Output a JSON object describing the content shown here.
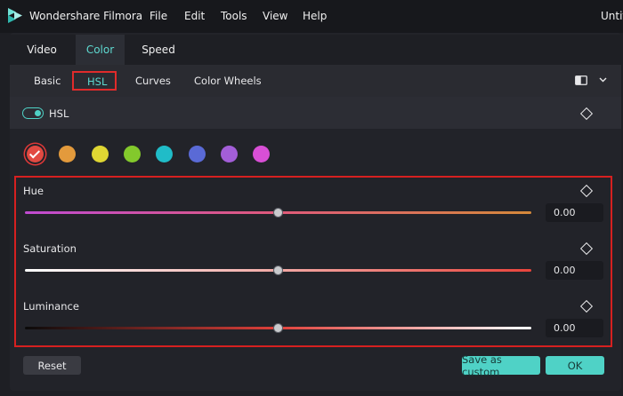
{
  "app": {
    "name": "Wondershare Filmora",
    "doc_title": "Untitled"
  },
  "menu": [
    "File",
    "Edit",
    "Tools",
    "View",
    "Help"
  ],
  "tabs": [
    {
      "label": "Video",
      "active": false
    },
    {
      "label": "Color",
      "active": true
    },
    {
      "label": "Speed",
      "active": false
    }
  ],
  "subtabs": [
    {
      "label": "Basic",
      "active": false
    },
    {
      "label": "HSL",
      "active": true
    },
    {
      "label": "Curves",
      "active": false
    },
    {
      "label": "Color Wheels",
      "active": false
    }
  ],
  "hsl_section": {
    "label": "HSL",
    "enabled": true
  },
  "swatches": [
    {
      "name": "red",
      "color": "#e24a42",
      "selected": true
    },
    {
      "name": "orange",
      "color": "#e39a3c",
      "selected": false
    },
    {
      "name": "yellow",
      "color": "#dfd633",
      "selected": false
    },
    {
      "name": "green",
      "color": "#83c92c",
      "selected": false
    },
    {
      "name": "cyan",
      "color": "#20bcc8",
      "selected": false
    },
    {
      "name": "blue",
      "color": "#5a6ad6",
      "selected": false
    },
    {
      "name": "purple",
      "color": "#a35ed8",
      "selected": false
    },
    {
      "name": "magenta",
      "color": "#d94fd6",
      "selected": false
    }
  ],
  "sliders": [
    {
      "label": "Hue",
      "value": "0.00",
      "position": 0.5
    },
    {
      "label": "Saturation",
      "value": "0.00",
      "position": 0.5
    },
    {
      "label": "Luminance",
      "value": "0.00",
      "position": 0.5
    }
  ],
  "buttons": {
    "reset": "Reset",
    "save_custom": "Save as custom",
    "ok": "OK"
  },
  "accent_color": "#4fd2c6",
  "highlight_color": "#d62020"
}
